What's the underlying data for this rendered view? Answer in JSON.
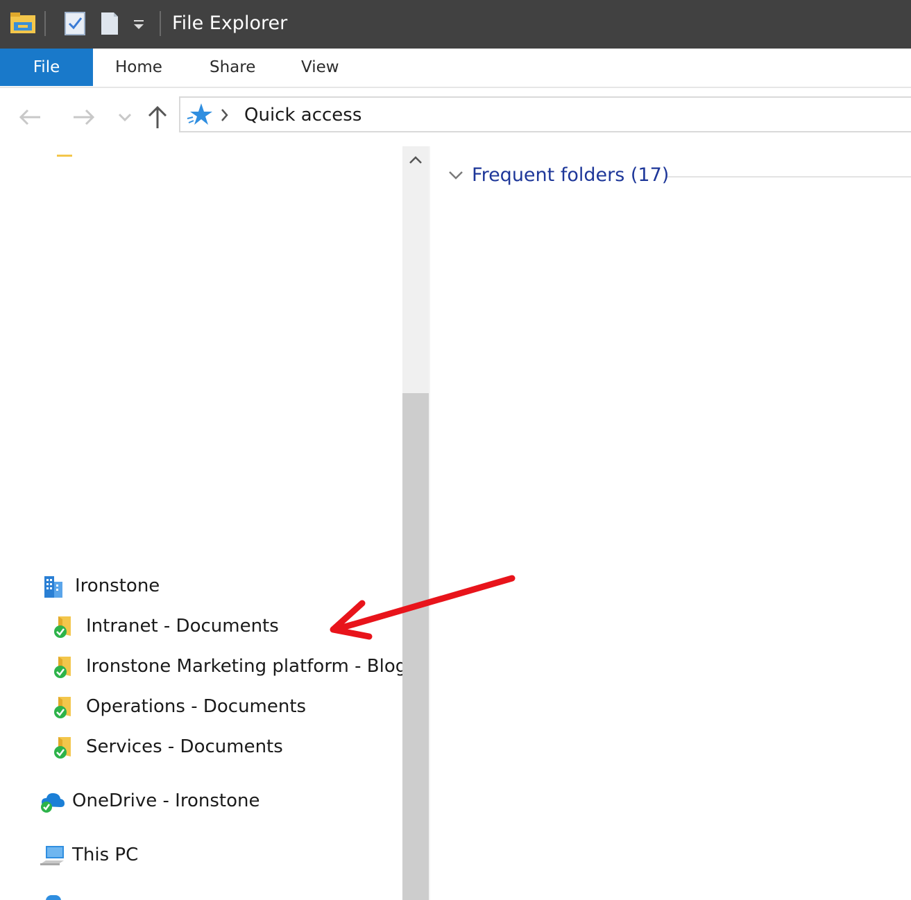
{
  "window": {
    "title": "File Explorer"
  },
  "ribbon": {
    "tabs": [
      {
        "label": "File"
      },
      {
        "label": "Home"
      },
      {
        "label": "Share"
      },
      {
        "label": "View"
      }
    ]
  },
  "address": {
    "location": "Quick access"
  },
  "nav_pane": {
    "items": [
      {
        "label": "Ironstone",
        "icon": "building-icon"
      },
      {
        "label": "Intranet - Documents",
        "icon": "synced-folder-icon"
      },
      {
        "label": "Ironstone Marketing platform - Blog",
        "icon": "synced-folder-icon"
      },
      {
        "label": "Operations - Documents",
        "icon": "synced-folder-icon"
      },
      {
        "label": "Services - Documents",
        "icon": "synced-folder-icon"
      },
      {
        "label": "OneDrive - Ironstone",
        "icon": "onedrive-icon"
      },
      {
        "label": "This PC",
        "icon": "this-pc-icon"
      }
    ]
  },
  "content": {
    "group_title": "Frequent folders (17)"
  },
  "colors": {
    "accent": "#1979ca",
    "titlebar": "#414141",
    "group_title": "#1e3799",
    "annotation": "#e8141b"
  }
}
